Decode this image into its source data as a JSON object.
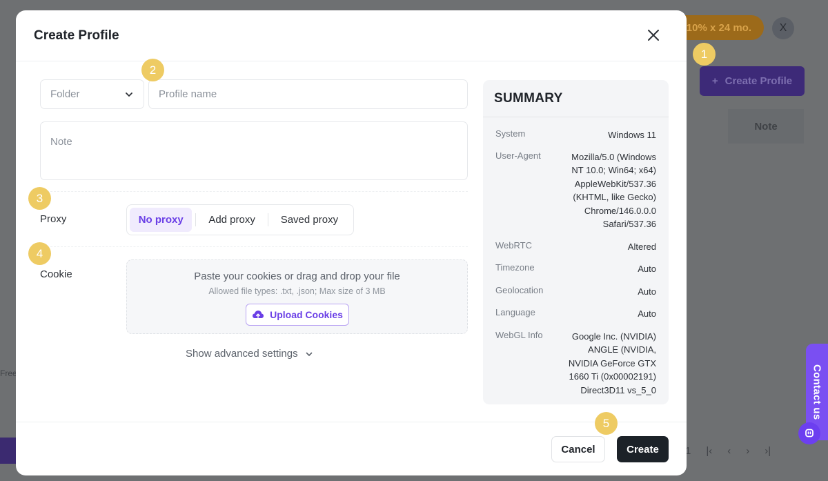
{
  "background": {
    "promo_text": "10% x 24 mo.",
    "close_label": "X",
    "create_profile_label": "Create Profile",
    "note_column": "Note",
    "free_text": "Free",
    "pager_first": "1",
    "contact_label": "Contact us"
  },
  "modal": {
    "title": "Create Profile",
    "folder_placeholder": "Folder",
    "profile_name_placeholder": "Profile name",
    "note_placeholder": "Note",
    "proxy": {
      "label": "Proxy",
      "options": [
        "No proxy",
        "Add proxy",
        "Saved proxy"
      ],
      "selected": "No proxy"
    },
    "cookie": {
      "label": "Cookie",
      "main_text": "Paste your cookies or drag and drop your file",
      "sub_text": "Allowed file types: .txt, .json; Max size of 3 MB",
      "upload_label": "Upload Cookies"
    },
    "advanced_label": "Show advanced settings",
    "summary": {
      "title": "SUMMARY",
      "rows": [
        {
          "key": "System",
          "value": "Windows 11"
        },
        {
          "key": "User-Agent",
          "value": "Mozilla/5.0 (Windows NT 10.0; Win64; x64) AppleWebKit/537.36 (KHTML, like Gecko) Chrome/146.0.0.0 Safari/537.36"
        },
        {
          "key": "WebRTC",
          "value": "Altered"
        },
        {
          "key": "Timezone",
          "value": "Auto"
        },
        {
          "key": "Geolocation",
          "value": "Auto"
        },
        {
          "key": "Language",
          "value": "Auto"
        },
        {
          "key": "WebGL Info",
          "value": "Google Inc. (NVIDIA) ANGLE (NVIDIA, NVIDIA GeForce GTX 1660 Ti (0x00002191) Direct3D11 vs_5_0"
        }
      ]
    },
    "footer": {
      "cancel_label": "Cancel",
      "create_label": "Create"
    }
  },
  "step_badges": [
    "1",
    "2",
    "3",
    "4",
    "5"
  ],
  "colors": {
    "accent": "#6a3fe6",
    "badge": "#eecb63",
    "create_button": "#1c2228"
  }
}
